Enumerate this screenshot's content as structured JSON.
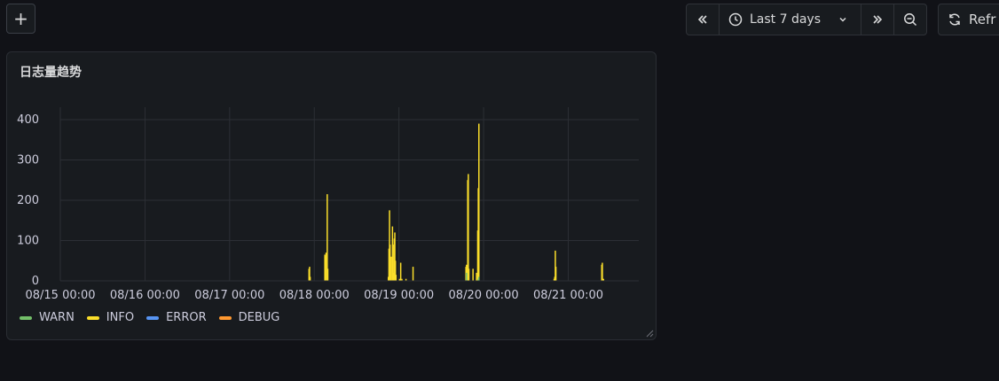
{
  "toolbar": {
    "add_label": "+",
    "time_range": "Last 7 days",
    "refresh_label": "Refr",
    "icons": [
      "chevron-double-left-icon",
      "clock-icon",
      "chevron-down-icon",
      "chevron-double-right-icon",
      "zoom-out-icon",
      "refresh-icon"
    ]
  },
  "panel": {
    "title": "日志量趋势"
  },
  "colors": {
    "WARN": "#73bf69",
    "INFO": "#fade2a",
    "ERROR": "#5794f2",
    "DEBUG": "#ff9830",
    "grid": "#2c2f35",
    "tick_text": "#ccccdc"
  },
  "chart_data": {
    "type": "bar",
    "title": "日志量趋势",
    "xlabel": "",
    "ylabel": "",
    "xlim": [
      "08/15 00:00",
      "08/21 20:00"
    ],
    "ylim": [
      0,
      400
    ],
    "yticks": [
      0,
      100,
      200,
      300,
      400
    ],
    "xticks": [
      "08/15 00:00",
      "08/16 00:00",
      "08/17 00:00",
      "08/18 00:00",
      "08/19 00:00",
      "08/20 00:00",
      "08/21 00:00"
    ],
    "grid": true,
    "legend_placement": "bottom-left",
    "legend": [
      "WARN",
      "INFO",
      "ERROR",
      "DEBUG"
    ],
    "series": [
      {
        "name": "INFO",
        "points": [
          [
            "08/17 22:30",
            30
          ],
          [
            "08/17 22:40",
            35
          ],
          [
            "08/17 22:50",
            10
          ],
          [
            "08/18 03:00",
            65
          ],
          [
            "08/18 03:10",
            60
          ],
          [
            "08/18 03:20",
            70
          ],
          [
            "08/18 03:40",
            215
          ],
          [
            "08/18 03:50",
            30
          ],
          [
            "08/18 21:00",
            10
          ],
          [
            "08/18 21:10",
            80
          ],
          [
            "08/18 21:20",
            175
          ],
          [
            "08/18 21:30",
            90
          ],
          [
            "08/18 21:50",
            60
          ],
          [
            "08/18 22:10",
            135
          ],
          [
            "08/18 22:20",
            90
          ],
          [
            "08/18 22:30",
            20
          ],
          [
            "08/18 22:40",
            105
          ],
          [
            "08/18 22:50",
            120
          ],
          [
            "08/18 23:00",
            50
          ],
          [
            "08/18 23:10",
            15
          ],
          [
            "08/19 00:10",
            5
          ],
          [
            "08/19 00:30",
            45
          ],
          [
            "08/19 00:50",
            5
          ],
          [
            "08/19 02:00",
            5
          ],
          [
            "08/19 04:00",
            35
          ],
          [
            "08/19 19:00",
            35
          ],
          [
            "08/19 19:10",
            40
          ],
          [
            "08/19 19:30",
            250
          ],
          [
            "08/19 19:40",
            265
          ],
          [
            "08/19 19:50",
            30
          ],
          [
            "08/19 21:00",
            30
          ],
          [
            "08/19 22:00",
            20
          ],
          [
            "08/19 22:20",
            125
          ],
          [
            "08/19 22:30",
            230
          ],
          [
            "08/19 22:40",
            390
          ],
          [
            "08/20 20:00",
            5
          ],
          [
            "08/20 20:10",
            10
          ],
          [
            "08/20 20:20",
            75
          ],
          [
            "08/20 20:30",
            35
          ],
          [
            "08/21 09:30",
            40
          ],
          [
            "08/21 09:40",
            45
          ],
          [
            "08/21 10:00",
            5
          ]
        ]
      },
      {
        "name": "WARN",
        "points": [
          [
            "08/19 19:10",
            20
          ],
          [
            "08/19 22:30",
            5
          ],
          [
            "08/19 22:40",
            10
          ]
        ]
      },
      {
        "name": "ERROR",
        "points": []
      },
      {
        "name": "DEBUG",
        "points": []
      }
    ]
  }
}
